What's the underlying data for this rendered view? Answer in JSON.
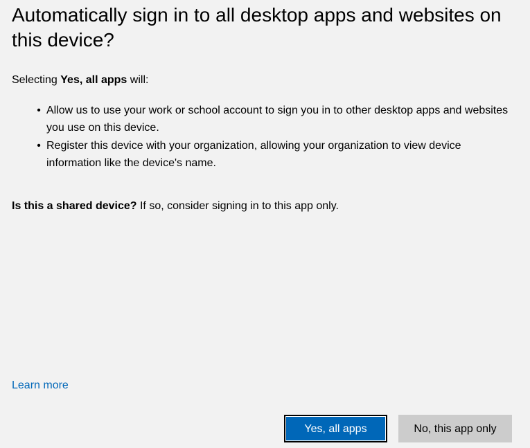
{
  "dialog": {
    "title": "Automatically sign in to all desktop apps and websites on this device?",
    "intro_prefix": "Selecting ",
    "intro_bold": "Yes, all apps",
    "intro_suffix": " will:",
    "bullets": [
      {
        "dot": "•",
        "text": "Allow us to use your work or school account to sign you in to other desktop apps and websites you use on this device."
      },
      {
        "dot": "•",
        "text": "Register this device with your organization, allowing your organization to view device information like the device's name."
      }
    ],
    "shared_bold": "Is this a shared device?",
    "shared_rest": " If so, consider signing in to this app only.",
    "learn_more": "Learn more",
    "buttons": {
      "yes_all_apps": "Yes, all apps",
      "no_this_app_only": "No, this app only"
    }
  },
  "colors": {
    "background": "#f2f2f2",
    "accent": "#0067b8",
    "secondary_button": "#cccccc",
    "link": "#0067b8"
  }
}
